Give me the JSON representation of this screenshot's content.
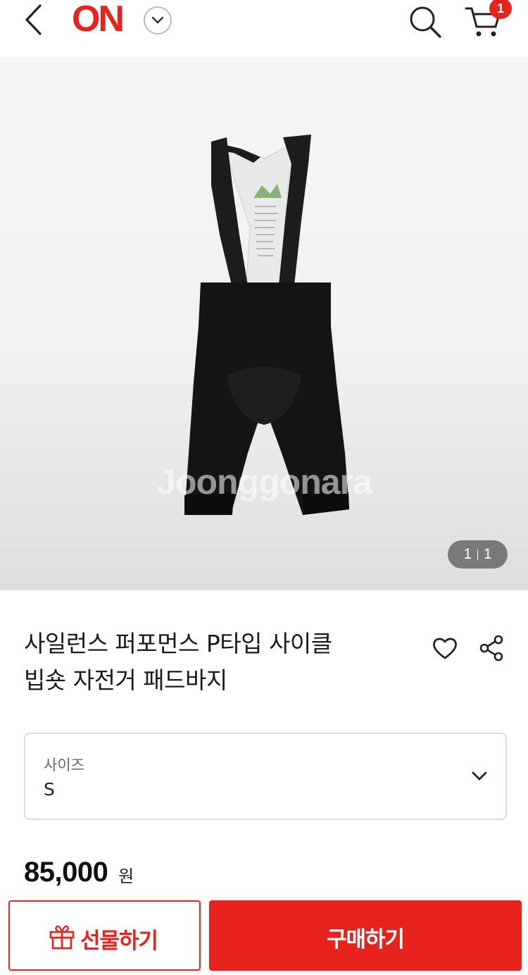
{
  "header": {
    "logo_text": "ON",
    "cart_count": "1",
    "icons": [
      "back-chevron-icon",
      "chevron-down-icon",
      "search-icon",
      "cart-icon"
    ],
    "accent_color": "#e8231e"
  },
  "gallery": {
    "watermark": "Joonggonara",
    "current": "1",
    "total": "1"
  },
  "product": {
    "title_line1": "사일런스 퍼포먼스 P타입 사이클",
    "title_line2": "빕숏 자전거 패드바지",
    "icons": [
      "heart-icon",
      "share-icon"
    ]
  },
  "option": {
    "label": "사이즈",
    "value": "S"
  },
  "price": {
    "amount": "85,000",
    "unit": "원"
  },
  "actions": {
    "gift_label": "선물하기",
    "buy_label": "구매하기"
  }
}
